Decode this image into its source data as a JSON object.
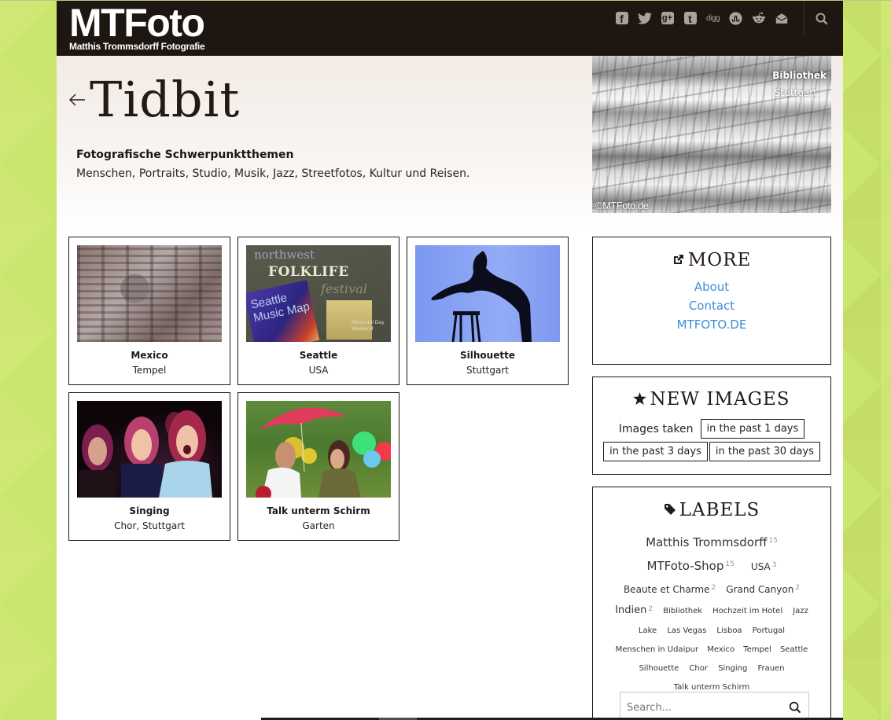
{
  "site": {
    "logo_main": "MTFoto",
    "logo_sub": "Matthis Trommsdorff Fotografie"
  },
  "header": {
    "social_icons": [
      "facebook-icon",
      "twitter-icon",
      "google-plus-icon",
      "tumblr-icon",
      "digg-icon",
      "stumbleupon-icon",
      "reddit-icon",
      "email-icon"
    ],
    "digg_label": "digg",
    "search_icon": "search-icon"
  },
  "hero": {
    "back_icon": "arrow-left-icon",
    "title": "Tidbit",
    "subhead": "Fotografische Schwerpunktthemen",
    "description": "Menschen, Portraits, Studio, Musik, Jazz, Streetfotos, Kultur und Reisen.",
    "featured": {
      "title": "Bibliothek",
      "subtitle": "Stuttgart",
      "copyright": "©MTFoto.de"
    }
  },
  "gallery": [
    {
      "title": "Mexico",
      "subtitle": "Tempel"
    },
    {
      "title": "Seattle",
      "subtitle": "USA",
      "image_text": {
        "top": "northwest",
        "main": "FOLKLIFE",
        "side": "festival",
        "map": "Seattle Music Map",
        "corner": "Memorial Day Weekend"
      }
    },
    {
      "title": "Silhouette",
      "subtitle": "Stuttgart"
    },
    {
      "title": "Singing",
      "subtitle": "Chor, Stuttgart"
    },
    {
      "title": "Talk unterm Schirm",
      "subtitle": "Garten"
    }
  ],
  "sidebar": {
    "more": {
      "icon": "external-link-icon",
      "heading": "MORE",
      "links": [
        "About",
        "Contact",
        "MTFOTO.DE"
      ]
    },
    "new_images": {
      "icon": "star-icon",
      "heading": "NEW IMAGES",
      "label": "Images taken",
      "buttons": [
        "in the past 1 days",
        "in the past 3 days",
        "in the past 30 days"
      ]
    },
    "labels": {
      "icon": "tag-icon",
      "heading": "LABELS",
      "items": [
        {
          "name": "Matthis Trommsdorff",
          "count": "15"
        },
        {
          "name": "MTFoto-Shop",
          "count": "15"
        },
        {
          "name": "USA",
          "count": "3"
        },
        {
          "name": "Beaute et Charme",
          "count": "2"
        },
        {
          "name": "Grand Canyon",
          "count": "2"
        },
        {
          "name": "Indien",
          "count": "2"
        },
        {
          "name": "Bibliothek",
          "count": ""
        },
        {
          "name": "Hochzeit im Hotel",
          "count": ""
        },
        {
          "name": "Jazz",
          "count": ""
        },
        {
          "name": "Lake",
          "count": ""
        },
        {
          "name": "Las Vegas",
          "count": ""
        },
        {
          "name": "Lisboa",
          "count": ""
        },
        {
          "name": "Portugal",
          "count": ""
        },
        {
          "name": "Menschen in Udaipur",
          "count": ""
        },
        {
          "name": "Mexico",
          "count": ""
        },
        {
          "name": "Tempel",
          "count": ""
        },
        {
          "name": "Seattle",
          "count": ""
        },
        {
          "name": "Silhouette",
          "count": ""
        },
        {
          "name": "Chor",
          "count": ""
        },
        {
          "name": "Singing",
          "count": ""
        },
        {
          "name": "Frauen",
          "count": ""
        },
        {
          "name": "Talk unterm Schirm",
          "count": ""
        }
      ]
    },
    "search": {
      "placeholder": "Search...",
      "value": ""
    }
  },
  "colors": {
    "header_bg": "#1e1611",
    "link": "#3c8fd6",
    "page_bg": "#c9e46a"
  }
}
